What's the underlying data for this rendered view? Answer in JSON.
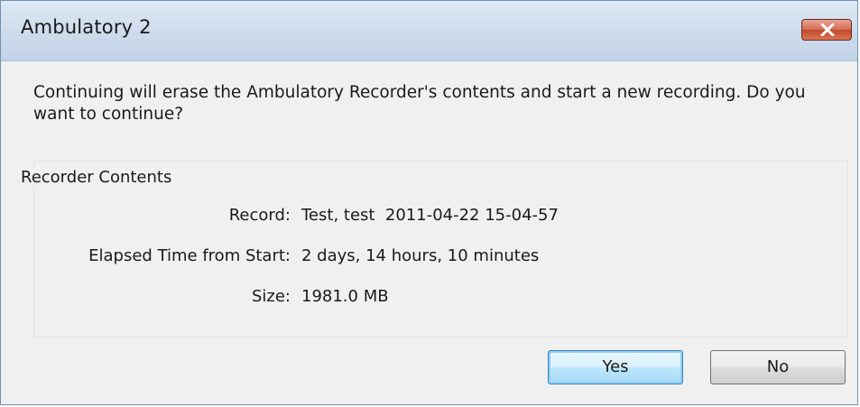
{
  "window": {
    "title": "Ambulatory 2",
    "close_icon": "close-x-icon"
  },
  "dialog": {
    "message": "Continuing will erase the Ambulatory Recorder's contents and start a new recording. Do you want to continue?",
    "group_title": "Recorder Contents",
    "rows": [
      {
        "label": "Record:",
        "value": "Test, test  2011-04-22 15-04-57"
      },
      {
        "label": "Elapsed Time from Start:",
        "value": "2 days, 14 hours, 10 minutes"
      },
      {
        "label": "Size:",
        "value": "1981.0 MB"
      }
    ]
  },
  "buttons": {
    "yes_label": "Yes",
    "no_label": "No"
  },
  "colors": {
    "titlebar": "#cddbeb",
    "close_button": "#c44a2e",
    "default_button_border": "#3c7fb1",
    "dialog_background": "#f0f0f0"
  }
}
